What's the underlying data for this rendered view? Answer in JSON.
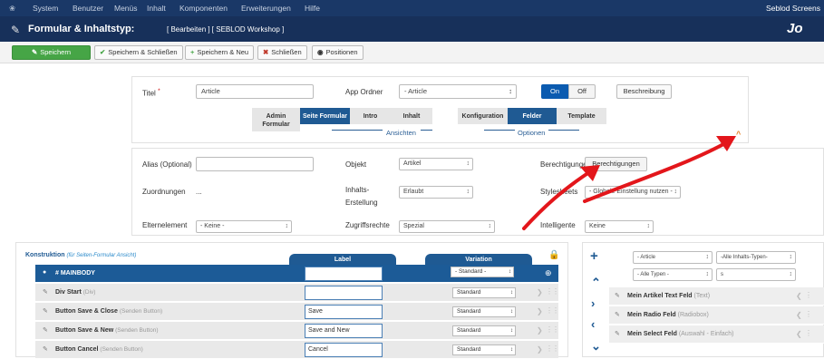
{
  "menubar": {
    "items": [
      "System",
      "Benutzer",
      "Menüs",
      "Inhalt",
      "Komponenten",
      "Erweiterungen",
      "Hilfe"
    ],
    "site_name": "Seblod Screens"
  },
  "titlebar": {
    "title": "Formular & Inhaltstyp:",
    "subtitle": "[ Bearbeiten ] [ SEBLOD Workshop ]",
    "logo_text": "Jo"
  },
  "toolbar": {
    "save": "Speichern",
    "save_close": "Speichern & Schließen",
    "save_new": "Speichern & Neu",
    "close": "Schließen",
    "positions": "Positionen"
  },
  "top_form": {
    "title_label": "Titel",
    "required_mark": "*",
    "title_value": "Article",
    "app_folder_label": "App Ordner",
    "app_folder_value": "- Article",
    "toggle_on": "On",
    "toggle_off": "Off",
    "description_button": "Beschreibung",
    "views": {
      "admin": "Admin Formular",
      "site": "Seite Formular",
      "intro": "Intro",
      "content": "Inhalt",
      "group_label": "Ansichten"
    },
    "options": {
      "config": "Konfiguration",
      "fields": "Felder",
      "template": "Template",
      "group_label": "Optionen"
    }
  },
  "settings": {
    "alias_label": "Alias (Optional)",
    "alias_value": "",
    "object_label": "Objekt",
    "object_value": "Artikel",
    "permissions_label": "Berechtigungen",
    "permissions_button": "Berechtigungen",
    "assignments_label": "Zuordnungen",
    "assignments_value": "...",
    "content_creation_label": "Inhalts-Erstellung",
    "content_creation_value": "Erlaubt",
    "stylesheets_label": "Stylesheets",
    "stylesheets_value": "- Globale Einstellung nutzen -",
    "parent_label": "Elternelement",
    "parent_value": "- Keine -",
    "access_label": "Zugriffsrechte",
    "access_value": "Spezial",
    "intelligent_label": "Intelligente",
    "intelligent_value": "Keine"
  },
  "construction": {
    "title": "Konstruktion",
    "subtitle": "(für Seiten-Formular Ansicht)",
    "label_col": "Label",
    "variation_col": "Variation",
    "rows": [
      {
        "name": "# MAINBODY",
        "type": "",
        "label": "",
        "variation": "- Standard -"
      },
      {
        "name": "Div Start",
        "type": "(Div)",
        "label": "",
        "variation": "Standard"
      },
      {
        "name": "Button Save & Close",
        "type": "(Senden Button)",
        "label": "Save",
        "variation": "Standard"
      },
      {
        "name": "Button Save & New",
        "type": "(Senden Button)",
        "label": "Save and New",
        "variation": "Standard"
      },
      {
        "name": "Button Cancel",
        "type": "(Senden Button)",
        "label": "Cancel",
        "variation": "Standard"
      }
    ]
  },
  "fields_pane": {
    "filter_1": "- Article",
    "filter_2": "-Alle Inhalts-Typen-",
    "filter_3": "- Alle Typen -",
    "filter_4": "s",
    "items": [
      {
        "name": "Mein Artikel Text Feld",
        "type": "(Text)"
      },
      {
        "name": "Mein Radio Feld",
        "type": "(Radiobox)"
      },
      {
        "name": "Mein Select Feld",
        "type": "(Auswahl - Einfach)"
      }
    ]
  },
  "colors": {
    "menubar": "#1a3867",
    "titlebar": "#17305a",
    "accent": "#1f5a93",
    "save": "#46a546",
    "annotation_arrow": "#e3161b"
  }
}
